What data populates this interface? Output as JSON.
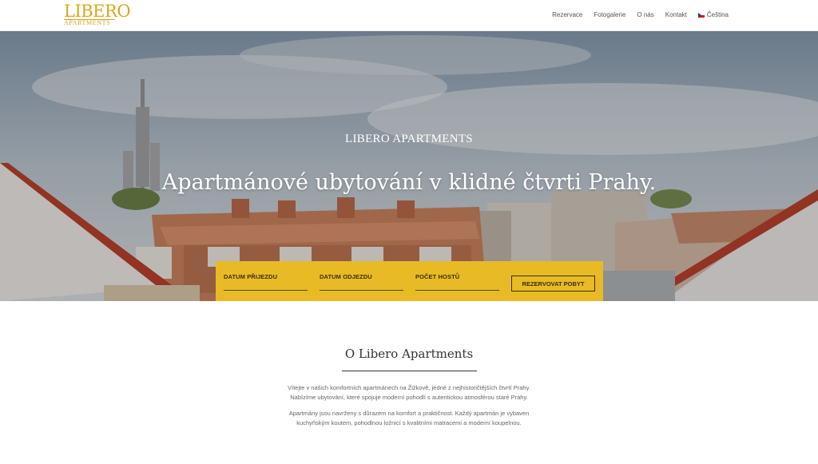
{
  "header": {
    "logo": {
      "line1": "LIBERO",
      "line2": "APARTMENTS"
    },
    "nav": [
      {
        "label": "Rezervace"
      },
      {
        "label": "Fotogalerie"
      },
      {
        "label": "O nás"
      },
      {
        "label": "Kontakt"
      },
      {
        "label": "Čeština",
        "icon": "czech-flag-icon"
      }
    ]
  },
  "hero": {
    "subtitle": "LIBERO APARTMENTS",
    "title": "Apartmánové ubytování v klidné čtvrti Prahy."
  },
  "booking": {
    "arrival_label": "DATUM PŘIJEZDU",
    "departure_label": "DATUM ODJEZDU",
    "guests_label": "POČET HOSTŮ",
    "button_label": "REZERVOVAT POBYT",
    "accent_color": "#e8ba26"
  },
  "about": {
    "title": "O Libero Apartments",
    "p1_line1": "Vítejte v našich komfortních apartmánech na Žižkově, jedné z nejhistoričtějších čtvrtí Prahy.",
    "p1_line2": "Nabízíme ubytování, které spojuje moderní pohodlí s autentickou atmosférou staré Prahy.",
    "p2_line1": "Apartmány jsou navrženy s důrazem na komfort a praktičnost. Každý apartmán je vybaven",
    "p2_line2": "kuchyňským koutem, pohodlnou ložnicí s kvalitními matracemi a moderní koupelnou."
  },
  "brand_color": "#d6a81d"
}
